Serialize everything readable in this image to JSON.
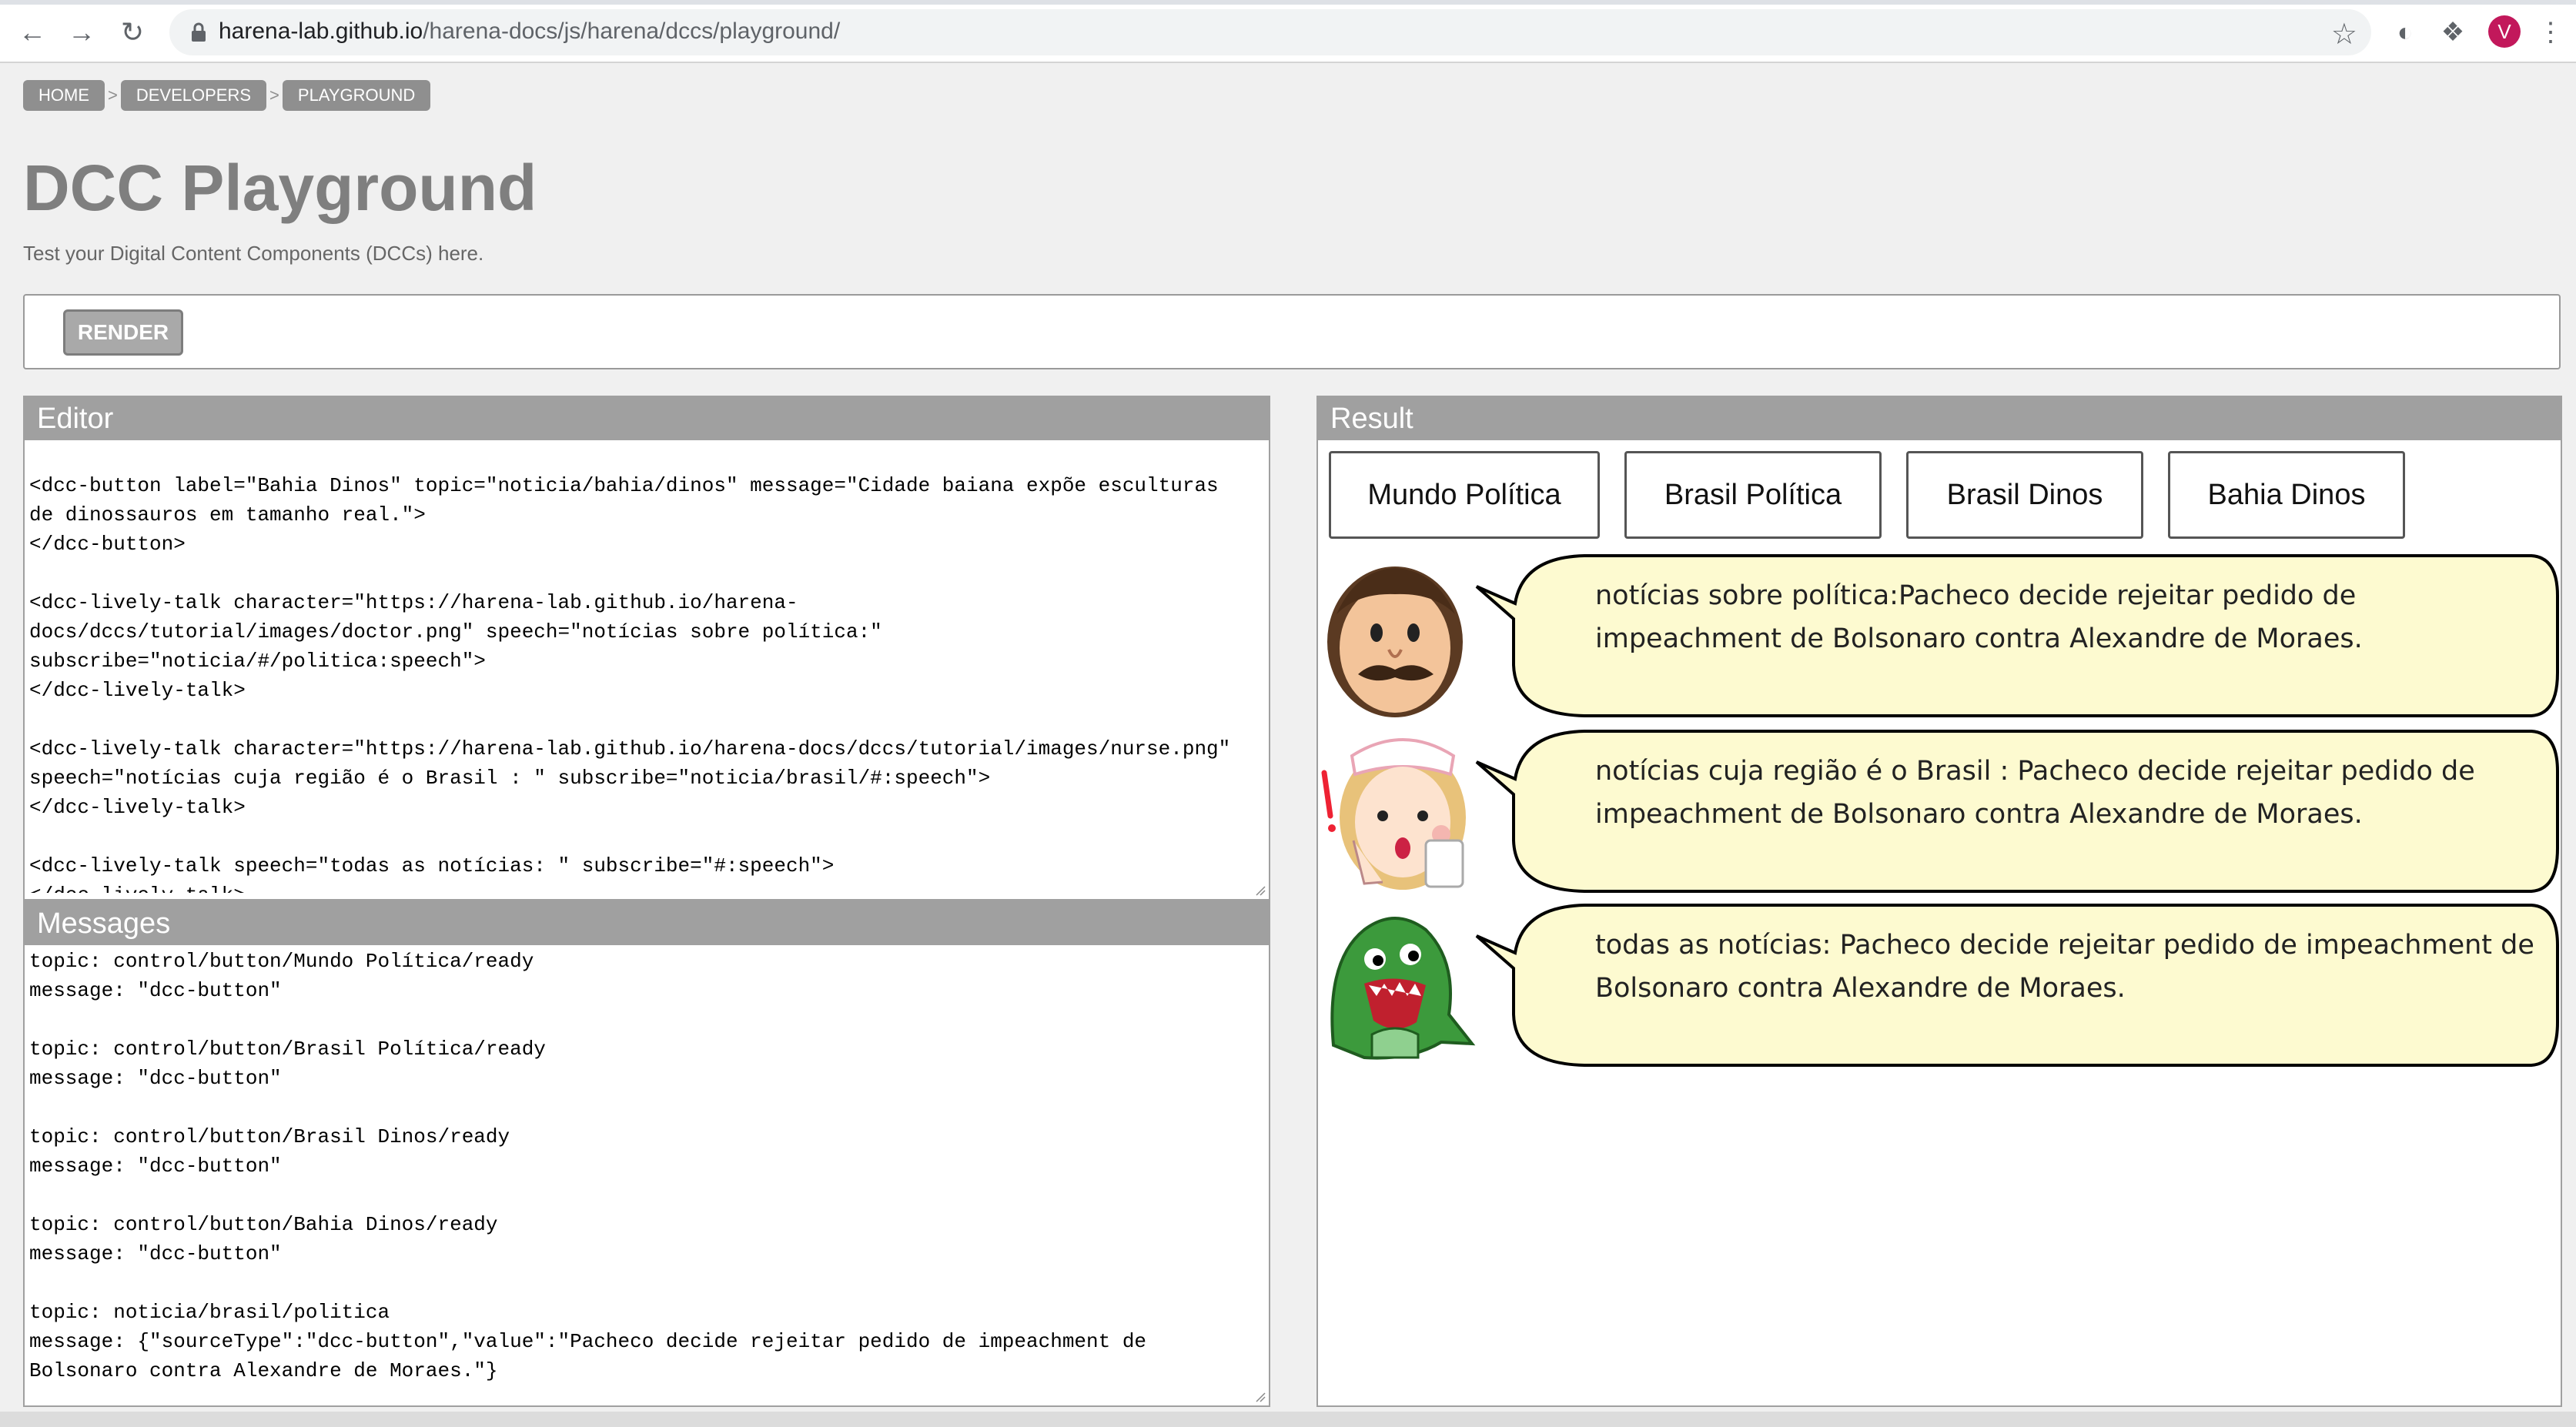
{
  "browser": {
    "url_host": "harena-lab.github.io",
    "url_path": "/harena-docs/js/harena/dccs/playground/",
    "profile_initial": "V"
  },
  "breadcrumb": [
    "HOME",
    "DEVELOPERS",
    "PLAYGROUND"
  ],
  "breadcrumb_separator": ">",
  "page": {
    "title": "DCC Playground",
    "subtitle": "Test your Digital Content Components (DCCs) here.",
    "render_label": "RENDER"
  },
  "editor": {
    "title": "Editor",
    "lines": [
      "<dcc-button label=\"Bahia Dinos\" topic=\"noticia/bahia/dinos\" message=\"Cidade baiana expõe esculturas",
      "de dinossauros em tamanho real.\">",
      "</dcc-button>",
      "",
      "<dcc-lively-talk character=\"https://harena-lab.github.io/harena-",
      "docs/dccs/tutorial/images/doctor.png\" speech=\"notícias sobre política:\"",
      "subscribe=\"noticia/#/politica:speech\">",
      "</dcc-lively-talk>",
      "",
      "<dcc-lively-talk character=\"https://harena-lab.github.io/harena-docs/dccs/tutorial/images/nurse.png\"",
      "speech=\"notícias cuja região é o Brasil : \" subscribe=\"noticia/brasil/#:speech\">",
      "</dcc-lively-talk>",
      "",
      "<dcc-lively-talk speech=\"todas as notícias: \" subscribe=\"#:speech\">",
      "</dcc-lively-talk>"
    ]
  },
  "messages": {
    "title": "Messages",
    "lines": [
      "topic: control/button/Mundo Política/ready",
      "message: \"dcc-button\"",
      "",
      "topic: control/button/Brasil Política/ready",
      "message: \"dcc-button\"",
      "",
      "topic: control/button/Brasil Dinos/ready",
      "message: \"dcc-button\"",
      "",
      "topic: control/button/Bahia Dinos/ready",
      "message: \"dcc-button\"",
      "",
      "topic: noticia/brasil/politica",
      "message: {\"sourceType\":\"dcc-button\",\"value\":\"Pacheco decide rejeitar pedido de impeachment de",
      "Bolsonaro contra Alexandre de Moraes.\"}"
    ]
  },
  "result": {
    "title": "Result",
    "buttons": [
      "Mundo Política",
      "Brasil Política",
      "Brasil Dinos",
      "Bahia Dinos"
    ],
    "talks": [
      {
        "character": "doctor",
        "speech": "notícias sobre política:Pacheco decide rejeitar pedido de impeachment de Bolsonaro contra Alexandre de Moraes."
      },
      {
        "character": "nurse",
        "speech": "notícias cuja região é o Brasil : Pacheco decide rejeitar pedido de impeachment de Bolsonaro contra Alexandre de Moraes."
      },
      {
        "character": "dinosaur",
        "speech": "todas as notícias: Pacheco decide rejeitar pedido de impeachment de Bolsonaro contra Alexandre de Moraes."
      }
    ]
  },
  "colors": {
    "bubble_fill": "#fdfad0",
    "panel_header": "#a0a0a0",
    "title_gray": "#7f7f7f"
  }
}
